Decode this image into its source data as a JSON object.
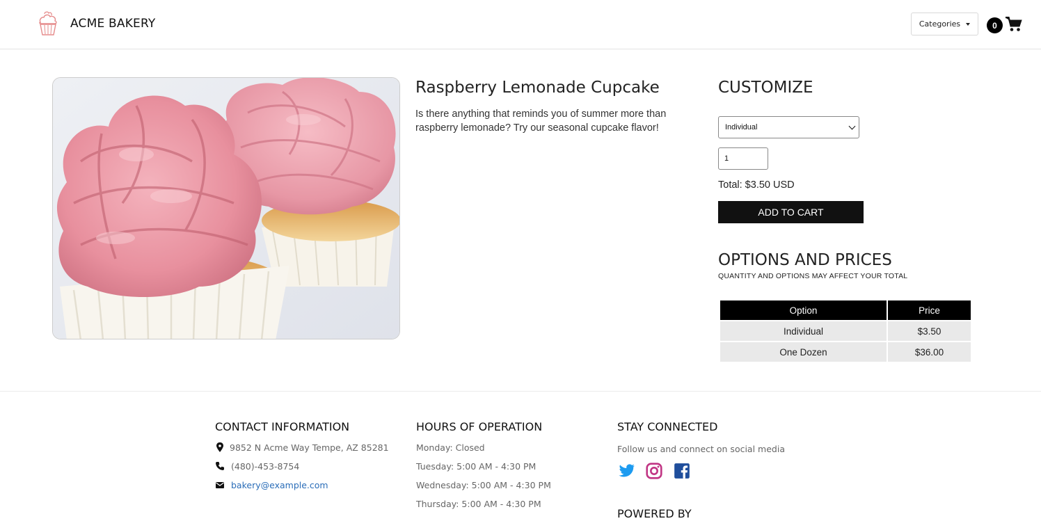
{
  "header": {
    "brand": "ACME BAKERY",
    "categories_label": "Categories",
    "cart_count": "0"
  },
  "product": {
    "title": "Raspberry Lemonade Cupcake",
    "description": "Is there anything that reminds you of summer more than raspberry lemonade? Try our seasonal cupcake flavor!"
  },
  "customize": {
    "title": "CUSTOMIZE",
    "selected_option": "Individual",
    "quantity": "1",
    "total": "Total: $3.50 USD",
    "add_to_cart": "ADD TO CART"
  },
  "options": {
    "title": "OPTIONS AND PRICES",
    "subtitle": "QUANTITY AND OPTIONS MAY AFFECT YOUR TOTAL",
    "headers": [
      "Option",
      "Price"
    ],
    "rows": [
      {
        "option": "Individual",
        "price": "$3.50"
      },
      {
        "option": "One Dozen",
        "price": "$36.00"
      }
    ]
  },
  "footer": {
    "contact": {
      "title": "CONTACT INFORMATION",
      "address": "9852 N Acme Way Tempe, AZ 85281",
      "phone": "(480)-453-8754",
      "email": "bakery@example.com"
    },
    "hours": {
      "title": "HOURS OF OPERATION",
      "days": [
        "Monday: Closed",
        "Tuesday: 5:00 AM - 4:30 PM",
        "Wednesday: 5:00 AM - 4:30 PM",
        "Thursday: 5:00 AM - 4:30 PM"
      ]
    },
    "social": {
      "title": "STAY CONNECTED",
      "text": "Follow us and connect on social media",
      "powered_by": "POWERED BY"
    }
  },
  "colors": {
    "accent_black": "#111111",
    "twitter": "#1d9bf0",
    "instagram": "#c13584",
    "facebook": "#1f4e9c",
    "link": "#2a6db8"
  }
}
